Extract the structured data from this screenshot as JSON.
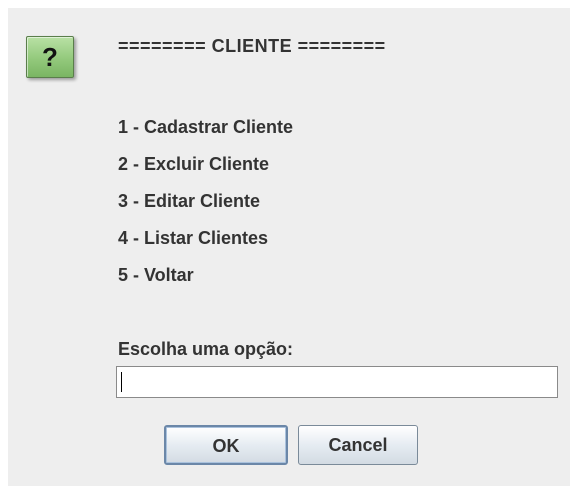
{
  "dialog": {
    "icon": "question-icon",
    "icon_glyph": "?",
    "accent_color": "#93c97c",
    "header": "======== CLIENTE ========",
    "options": [
      "1 - Cadastrar Cliente",
      "2 - Excluir Cliente",
      "3 - Editar Cliente",
      "4 - Listar Clientes",
      "5 - Voltar"
    ],
    "prompt": "Escolha uma opção:",
    "input_value": "",
    "buttons": {
      "ok_label": "OK",
      "cancel_label": "Cancel"
    }
  }
}
